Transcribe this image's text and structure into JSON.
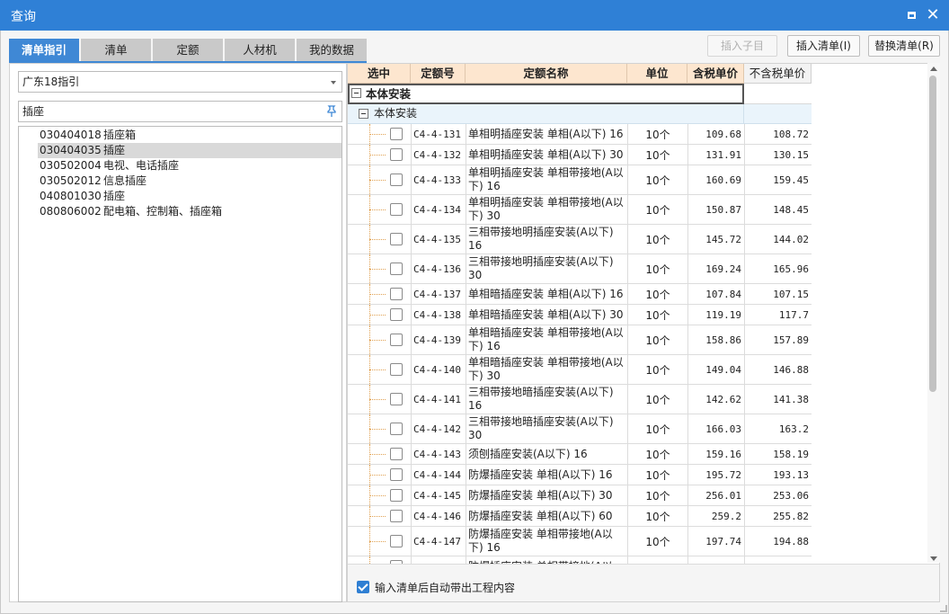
{
  "window": {
    "title": "查询",
    "maximize_icon": "maximize-icon",
    "close_icon": "close-icon"
  },
  "tabs": [
    "清单指引",
    "清单",
    "定额",
    "人材机",
    "我的数据"
  ],
  "toolbar": {
    "insert_sub": "插入子目",
    "insert_list": "插入清单(I)",
    "replace_list": "替换清单(R)"
  },
  "left": {
    "combo_value": "广东18指引",
    "search_value": "插座",
    "search_icon": "pin-icon",
    "list": [
      {
        "code": "030404018",
        "name": "插座箱"
      },
      {
        "code": "030404035",
        "name": "插座"
      },
      {
        "code": "030502004",
        "name": "电视、电话插座"
      },
      {
        "code": "030502012",
        "name": "信息插座"
      },
      {
        "code": "040801030",
        "name": "插座"
      },
      {
        "code": "080806002",
        "name": "配电箱、控制箱、插座箱"
      }
    ],
    "selected_index": 1
  },
  "grid": {
    "headers": [
      "选中",
      "定额号",
      "定额名称",
      "单位",
      "含税单价",
      "不含税单价"
    ],
    "group1": "本体安装",
    "group2": "本体安装",
    "rows": [
      {
        "code": "C4-4-131",
        "name": "单相明插座安装 单相(A以下) 16",
        "unit": "10个",
        "price_tax": "109.68",
        "price_notax": "108.72"
      },
      {
        "code": "C4-4-132",
        "name": "单相明插座安装 单相(A以下) 30",
        "unit": "10个",
        "price_tax": "131.91",
        "price_notax": "130.15"
      },
      {
        "code": "C4-4-133",
        "name": "单相明插座安装 单相带接地(A以下) 16",
        "unit": "10个",
        "price_tax": "160.69",
        "price_notax": "159.45"
      },
      {
        "code": "C4-4-134",
        "name": "单相明插座安装 单相带接地(A以下) 30",
        "unit": "10个",
        "price_tax": "150.87",
        "price_notax": "148.45"
      },
      {
        "code": "C4-4-135",
        "name": "三相带接地明插座安装(A以下) 16",
        "unit": "10个",
        "price_tax": "145.72",
        "price_notax": "144.02"
      },
      {
        "code": "C4-4-136",
        "name": "三相带接地明插座安装(A以下) 30",
        "unit": "10个",
        "price_tax": "169.24",
        "price_notax": "165.96"
      },
      {
        "code": "C4-4-137",
        "name": "单相暗插座安装 单相(A以下) 16",
        "unit": "10个",
        "price_tax": "107.84",
        "price_notax": "107.15"
      },
      {
        "code": "C4-4-138",
        "name": "单相暗插座安装 单相(A以下) 30",
        "unit": "10个",
        "price_tax": "119.19",
        "price_notax": "117.7"
      },
      {
        "code": "C4-4-139",
        "name": "单相暗插座安装 单相带接地(A以下) 16",
        "unit": "10个",
        "price_tax": "158.86",
        "price_notax": "157.89"
      },
      {
        "code": "C4-4-140",
        "name": "单相暗插座安装 单相带接地(A以下) 30",
        "unit": "10个",
        "price_tax": "149.04",
        "price_notax": "146.88"
      },
      {
        "code": "C4-4-141",
        "name": "三相带接地暗插座安装(A以下) 16",
        "unit": "10个",
        "price_tax": "142.62",
        "price_notax": "141.38"
      },
      {
        "code": "C4-4-142",
        "name": "三相带接地暗插座安装(A以下) 30",
        "unit": "10个",
        "price_tax": "166.03",
        "price_notax": "163.2"
      },
      {
        "code": "C4-4-143",
        "name": "须刨插座安装(A以下) 16",
        "unit": "10个",
        "price_tax": "159.16",
        "price_notax": "158.19"
      },
      {
        "code": "C4-4-144",
        "name": "防爆插座安装 单相(A以下) 16",
        "unit": "10个",
        "price_tax": "195.72",
        "price_notax": "193.13"
      },
      {
        "code": "C4-4-145",
        "name": "防爆插座安装 单相(A以下) 30",
        "unit": "10个",
        "price_tax": "256.01",
        "price_notax": "253.06"
      },
      {
        "code": "C4-4-146",
        "name": "防爆插座安装 单相(A以下) 60",
        "unit": "10个",
        "price_tax": "259.2",
        "price_notax": "255.82"
      },
      {
        "code": "C4-4-147",
        "name": "防爆插座安装 单相带接地(A以下) 16",
        "unit": "10个",
        "price_tax": "197.74",
        "price_notax": "194.88"
      },
      {
        "code": "",
        "name": "防爆插座安装 单相带接地(A以",
        "unit": "",
        "price_tax": "",
        "price_notax": ""
      }
    ]
  },
  "bottom": {
    "auto_checkbox_label": "输入清单后自动带出工程内容",
    "auto_checked": true
  },
  "colors": {
    "title_bg": "#2f80d6",
    "tab_active": "#3f88d5",
    "header_bg": "#fde6cf"
  }
}
